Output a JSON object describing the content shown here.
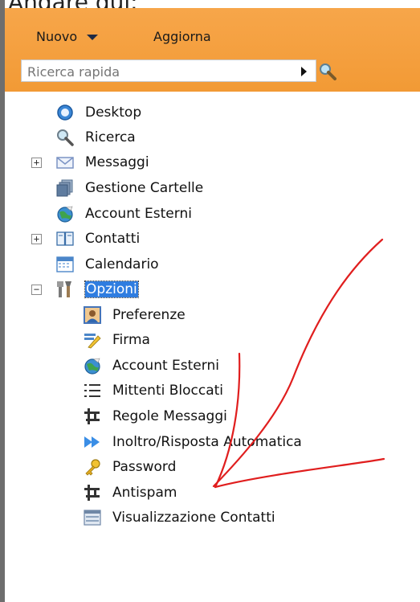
{
  "caption": "Andare qui:",
  "menu": {
    "new_label": "Nuovo",
    "refresh_label": "Aggiorna"
  },
  "search": {
    "placeholder": "Ricerca rapida"
  },
  "tree": {
    "desktop": "Desktop",
    "ricerca": "Ricerca",
    "messaggi": "Messaggi",
    "gestione": "Gestione Cartelle",
    "account": "Account Esterni",
    "contatti": "Contatti",
    "calendario": "Calendario",
    "opzioni": "Opzioni",
    "children": {
      "preferenze": "Preferenze",
      "firma": "Firma",
      "account": "Account Esterni",
      "mittenti": "Mittenti Bloccati",
      "regole": "Regole Messaggi",
      "inoltro": "Inoltro/Risposta Automatica",
      "password": "Password",
      "antispam": "Antispam",
      "visualizzazione": "Visualizzazione Contatti"
    }
  },
  "colors": {
    "header": "#f29a35",
    "selection": "#2f7de0",
    "annotation": "#e01e1e"
  }
}
